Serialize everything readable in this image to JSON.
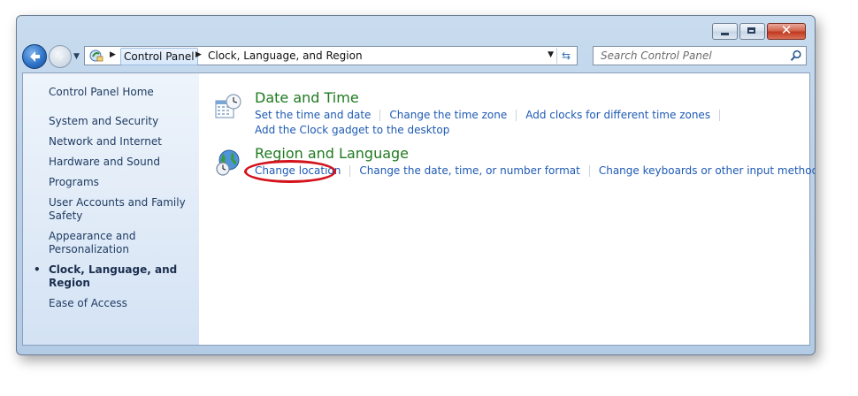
{
  "window": {
    "title": "Clock, Language, and Region"
  },
  "nav": {
    "breadcrumbs": [
      "Control Panel",
      "Clock, Language, and Region"
    ],
    "search_placeholder": "Search Control Panel"
  },
  "sidebar": {
    "home": "Control Panel Home",
    "items": [
      {
        "label": "System and Security"
      },
      {
        "label": "Network and Internet"
      },
      {
        "label": "Hardware and Sound"
      },
      {
        "label": "Programs"
      },
      {
        "label": "User Accounts and Family Safety"
      },
      {
        "label": "Appearance and Personalization"
      },
      {
        "label": "Clock, Language, and Region",
        "current": true
      },
      {
        "label": "Ease of Access"
      }
    ]
  },
  "categories": [
    {
      "title": "Date and Time",
      "icon": "calendar-clock-icon",
      "links": [
        "Set the time and date",
        "Change the time zone",
        "Add clocks for different time zones",
        "Add the Clock gadget to the desktop"
      ]
    },
    {
      "title": "Region and Language",
      "icon": "globe-clock-icon",
      "links": [
        "Change location",
        "Change the date, time, or number format",
        "Change keyboards or other input methods"
      ]
    }
  ],
  "colors": {
    "link": "#1e5ab4",
    "category_title": "#1e7a1e",
    "highlight": "#d4121b"
  }
}
